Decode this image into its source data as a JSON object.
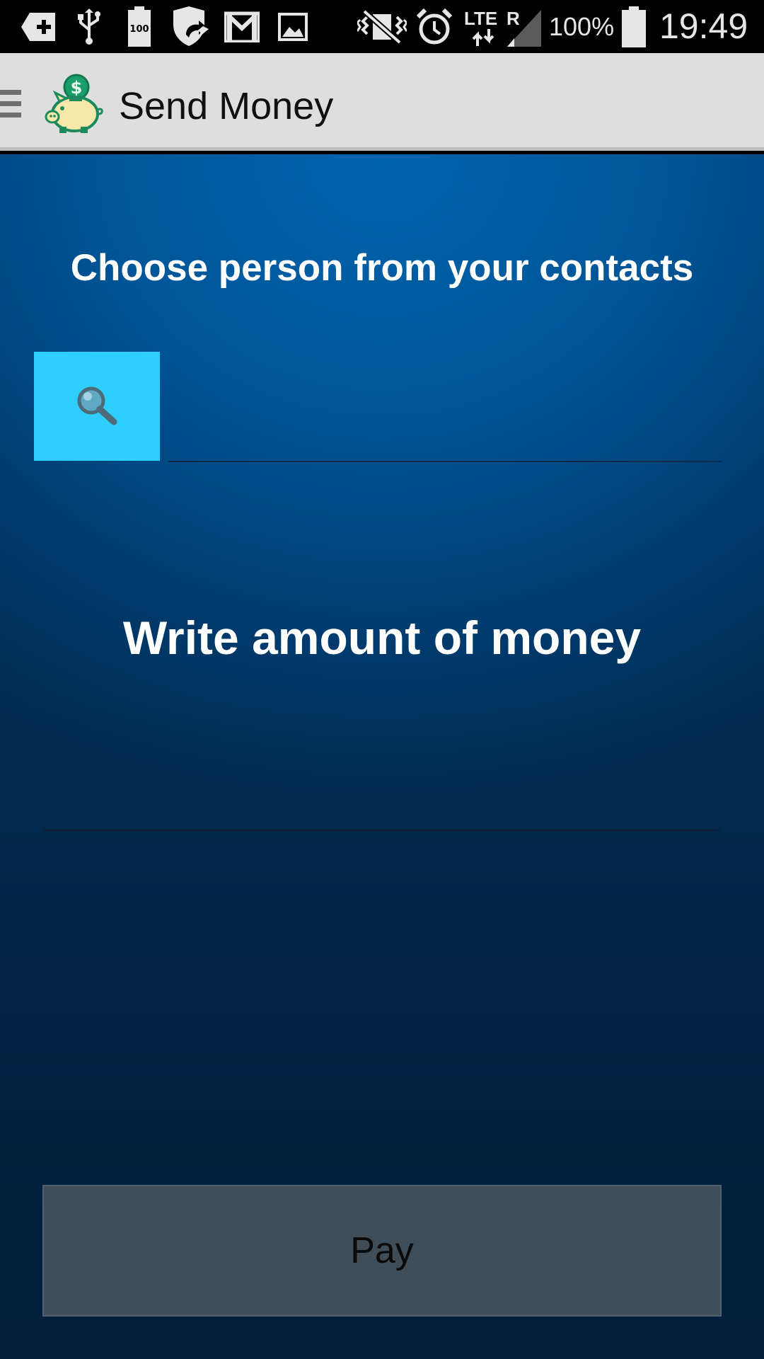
{
  "status_bar": {
    "battery_percent": "100%",
    "time": "19:49",
    "network_label": "LTE",
    "roaming_label": "R",
    "battery_small_label": "100",
    "icons": [
      "add-icon",
      "usb-icon",
      "battery-saver-icon",
      "shield-sync-icon",
      "gmail-icon",
      "image-icon",
      "vibrate-mute-icon",
      "alarm-icon",
      "lte-signal-icon",
      "signal-icon",
      "battery-icon"
    ]
  },
  "action_bar": {
    "title": "Send Money",
    "logo": "piggy-bank-dollar-icon",
    "drawer": "menu-icon"
  },
  "main": {
    "contacts_heading": "Choose person from your contacts",
    "contact_input_value": "",
    "amount_heading": "Write amount of money",
    "amount_input_value": "",
    "pay_label": "Pay"
  },
  "colors": {
    "action_bar_bg": "#dedede",
    "search_button_bg": "#2ecfff",
    "pay_button_bg": "#3f4d58",
    "content_top": "#0064ad",
    "content_bottom": "#022a4f"
  }
}
